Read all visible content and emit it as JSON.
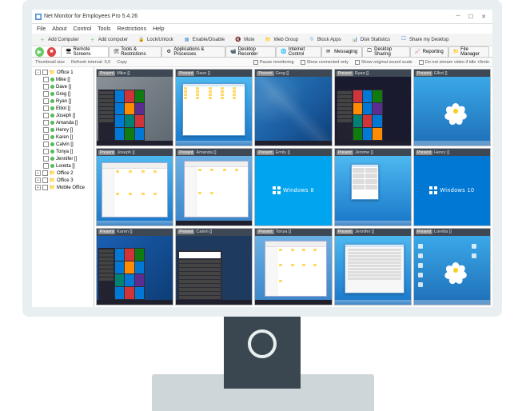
{
  "window_title": "Net Monitor for Employees Pro 5.4.26",
  "menu": [
    "File",
    "About",
    "Control",
    "Tools",
    "Restrictions",
    "Help"
  ],
  "toolbar1": [
    {
      "label": "Add Computer",
      "icon": "plus",
      "color": "green"
    },
    {
      "label": "Add computer",
      "icon": "plus",
      "color": "green"
    },
    {
      "label": "Lock/Unlock",
      "icon": "lock",
      "color": "blue"
    },
    {
      "label": "Enable/Disable",
      "icon": "grid",
      "color": "blue"
    },
    {
      "label": "Mute",
      "icon": "mute",
      "color": "blue"
    },
    {
      "label": "Web Group",
      "icon": "folder",
      "color": "blue"
    },
    {
      "label": "Block Apps",
      "icon": "block",
      "color": "blue"
    },
    {
      "label": "Disk Statistics",
      "icon": "chart",
      "color": "blue"
    },
    {
      "label": "Share my Desktop",
      "icon": "share",
      "color": "blue"
    }
  ],
  "tabs": [
    {
      "label": "Remote Screens",
      "active": true
    },
    {
      "label": "Tools & Restrictions",
      "active": false
    },
    {
      "label": "Applications & Processes",
      "active": false
    },
    {
      "label": "Desktop Recorder",
      "active": false
    },
    {
      "label": "Internet Control",
      "active": false
    },
    {
      "label": "Messaging",
      "active": false
    },
    {
      "label": "Desktop Sharing",
      "active": false
    },
    {
      "label": "Reporting",
      "active": false
    },
    {
      "label": "File Manager",
      "active": false
    }
  ],
  "subtoolbar": {
    "left": [
      "Thumbnail size",
      "Refresh interval: 5,0",
      "Copy"
    ],
    "right": [
      {
        "label": "Pause monitoring"
      },
      {
        "label": "Show connected only"
      },
      {
        "label": "Show original sound scale"
      },
      {
        "label": "Do not stream video if idle +5min"
      }
    ]
  },
  "tree": {
    "groups": [
      {
        "name": "Office 1",
        "expanded": true,
        "children": [
          {
            "name": "Mike []",
            "status": "online"
          },
          {
            "name": "Dave []",
            "status": "online"
          },
          {
            "name": "Greg []",
            "status": "online"
          },
          {
            "name": "Ryan []",
            "status": "online"
          },
          {
            "name": "Elliot []",
            "status": "online"
          },
          {
            "name": "Joseph []",
            "status": "online"
          },
          {
            "name": "Amanda []",
            "status": "online"
          },
          {
            "name": "Henry []",
            "status": "online"
          },
          {
            "name": "Karen []",
            "status": "online"
          },
          {
            "name": "Calvin []",
            "status": "online"
          },
          {
            "name": "Tonya []",
            "status": "online"
          },
          {
            "name": "Jennifer []",
            "status": "online"
          },
          {
            "name": "Loretta []",
            "status": "online"
          }
        ]
      },
      {
        "name": "Office 2",
        "expanded": false,
        "children": []
      },
      {
        "name": "Office 3",
        "expanded": false,
        "children": []
      },
      {
        "name": "Mobile Office",
        "expanded": false,
        "children": []
      }
    ]
  },
  "thumbnails": [
    {
      "user": "Mike []",
      "badge": "Present",
      "type": "win10start-dark"
    },
    {
      "user": "Dave []",
      "badge": "Present",
      "type": "win7-explorer"
    },
    {
      "user": "Greg []",
      "badge": "Present",
      "type": "blue-abstract"
    },
    {
      "user": "Ryan []",
      "badge": "Present",
      "type": "win10start-tiles"
    },
    {
      "user": "Elliot []",
      "badge": "Present",
      "type": "flower-desktop"
    },
    {
      "user": "Joseph []",
      "badge": "Present",
      "type": "win7-files"
    },
    {
      "user": "Amanda []",
      "badge": "Present",
      "type": "win10-explorer"
    },
    {
      "user": "Emily []",
      "badge": "Present",
      "type": "win8-logo"
    },
    {
      "user": "Jerome []",
      "badge": "Present",
      "type": "win7-gadgets"
    },
    {
      "user": "Henry []",
      "badge": "Present",
      "type": "win10-logo"
    },
    {
      "user": "Karen []",
      "badge": "Present",
      "type": "win10start-blue"
    },
    {
      "user": "Calvin []",
      "badge": "Present",
      "type": "win10start-search"
    },
    {
      "user": "Tonya []",
      "badge": "Present",
      "type": "win10-explorer2"
    },
    {
      "user": "Jennifer []",
      "badge": "Present",
      "type": "win7-dialog"
    },
    {
      "user": "Loretta []",
      "badge": "Present",
      "type": "flower-icons"
    }
  ],
  "win8_text": "Windows 8",
  "win10_text": "Windows 10"
}
